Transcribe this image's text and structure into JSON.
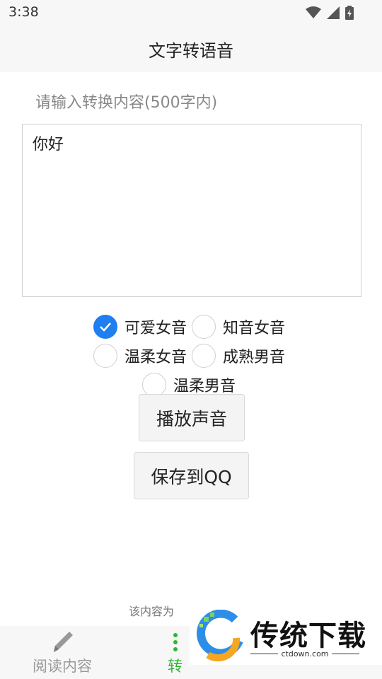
{
  "status_bar": {
    "time": "3:38"
  },
  "app_bar": {
    "title": "文字转语音"
  },
  "input": {
    "label": "请输入转换内容(500字内)",
    "value": "你好"
  },
  "voices": [
    {
      "label": "可爱女音",
      "checked": true
    },
    {
      "label": "知音女音",
      "checked": false
    },
    {
      "label": "温柔女音",
      "checked": false
    },
    {
      "label": "成熟男音",
      "checked": false
    },
    {
      "label": "温柔男音",
      "checked": false
    }
  ],
  "buttons": {
    "play": "播放声音",
    "save": "保存到QQ"
  },
  "footer_note": "该内容为",
  "bottom_nav": [
    {
      "label": "阅读内容",
      "icon": "pencil-icon",
      "active": false
    },
    {
      "label": "转",
      "icon": "menu-dots-icon",
      "active": true
    }
  ],
  "watermark": {
    "brand": "传统下载",
    "site": "ctdown.com"
  },
  "colors": {
    "accent": "#1e7ff0",
    "nav_active": "#2fb52f",
    "nav_inactive": "#999999"
  }
}
